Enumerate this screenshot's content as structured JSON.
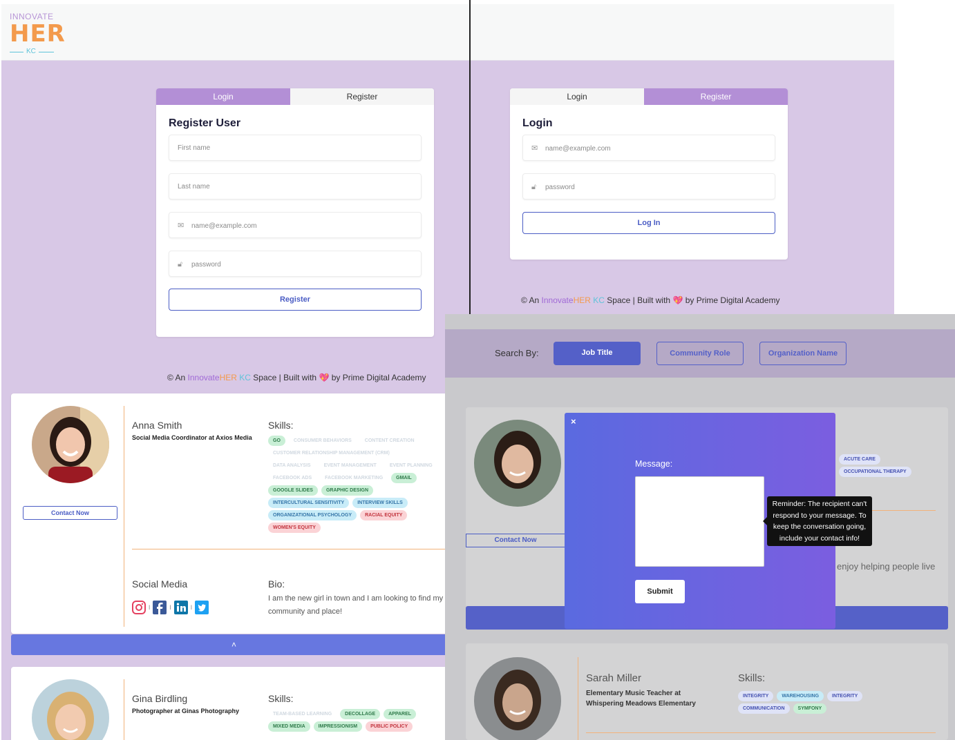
{
  "logo": {
    "top": "INNOVATE",
    "main": "HER",
    "bottom": "KC"
  },
  "register_card": {
    "tabs": [
      "Login",
      "Register"
    ],
    "title": "Register User",
    "first_name_placeholder": "First name",
    "last_name_placeholder": "Last name",
    "email_placeholder": "name@example.com",
    "password_placeholder": "password",
    "submit": "Register"
  },
  "login_card": {
    "tabs": [
      "Login",
      "Register"
    ],
    "title": "Login",
    "email_placeholder": "name@example.com",
    "password_placeholder": "password",
    "submit": "Log In"
  },
  "footer": {
    "prefix": "© An ",
    "brand_a": "Innovate",
    "brand_b": "HER",
    "brand_c": "KC",
    "suffix": " Space | Built with",
    "heart": "💖",
    "by": "by Prime Digital Academy"
  },
  "search": {
    "label": "Search By:",
    "buttons": [
      "Job Title",
      "Community Role",
      "Organization Name"
    ]
  },
  "profiles": [
    {
      "name": "Anna Smith",
      "role": "Social Media Coordinator at Axios Media",
      "skills_title": "Skills:",
      "contact": "Contact Now",
      "social_title": "Social Media",
      "bio_title": "Bio:",
      "bio": "I am the new girl in town and I am looking to find my community and place!",
      "collapse": "˄",
      "skills": [
        {
          "label": "GO",
          "color": "green"
        },
        {
          "label": "CONSUMER BEHAVIORS",
          "color": "faded"
        },
        {
          "label": "CONTENT CREATION",
          "color": "faded"
        },
        {
          "label": "CUSTOMER RELATIONSHIP MANAGEMENT (CRM)",
          "color": "faded"
        },
        {
          "label": "DATA ANALYSIS",
          "color": "faded"
        },
        {
          "label": "EVENT MANAGEMENT",
          "color": "faded"
        },
        {
          "label": "EVENT PLANNING",
          "color": "faded"
        },
        {
          "label": "FACEBOOK ADS",
          "color": "faded"
        },
        {
          "label": "FACEBOOK MARKETING",
          "color": "faded"
        },
        {
          "label": "GMAIL",
          "color": "green"
        },
        {
          "label": "GOOGLE SLIDES",
          "color": "green"
        },
        {
          "label": "GRAPHIC DESIGN",
          "color": "green"
        },
        {
          "label": "INTERCULTURAL SENSITIVITY",
          "color": "blue"
        },
        {
          "label": "INTERVIEW SKILLS",
          "color": "blue"
        },
        {
          "label": "ORGANIZATIONAL PSYCHOLOGY",
          "color": "blue"
        },
        {
          "label": "RACIAL EQUITY",
          "color": "red"
        },
        {
          "label": "WOMEN'S EQUITY",
          "color": "red"
        }
      ]
    },
    {
      "name": "Gina Birdling",
      "role": "Photographer at Ginas Photography",
      "skills_title": "Skills:",
      "skills": [
        {
          "label": "TEAM-BASED LEARNING",
          "color": "faded"
        },
        {
          "label": "DECOLLAGE",
          "color": "green"
        },
        {
          "label": "APPAREL",
          "color": "green"
        },
        {
          "label": "MIXED MEDIA",
          "color": "green"
        },
        {
          "label": "IMPRESSIONISM",
          "color": "green"
        },
        {
          "label": "PUBLIC POLICY",
          "color": "red"
        }
      ]
    },
    {
      "contact": "Contact Now",
      "skills": [
        {
          "label": "ACUTE CARE",
          "color": "indigo"
        },
        {
          "label": "OCCUPATIONAL THERAPY",
          "color": "indigo"
        }
      ],
      "bio_partial": "enjoy helping people live"
    },
    {
      "name": "Sarah Miller",
      "role": "Elementary Music Teacher at Whispering Meadows Elementary",
      "skills_title": "Skills:",
      "skills": [
        {
          "label": "INTEGRITY",
          "color": "indigo"
        },
        {
          "label": "WAREHOUSING",
          "color": "blue"
        },
        {
          "label": "INTEGRITY",
          "color": "indigo"
        },
        {
          "label": "COMMUNICATION",
          "color": "indigo"
        },
        {
          "label": "SYMFONY",
          "color": "green"
        }
      ]
    }
  ],
  "modal": {
    "close": "×",
    "label": "Message:",
    "submit": "Submit",
    "tooltip": "Reminder: The recipient can't respond to your message. To keep the conversation going, include your contact info!"
  },
  "colors": {
    "lavender": "#d8c8e6",
    "tab_active": "#b38fd6",
    "accent_blue": "#4a5cc4",
    "collapse_bar": "#6777e0"
  },
  "icons": {
    "email": "envelope-icon",
    "password": "lock-icon",
    "social": [
      "instagram-icon",
      "facebook-icon",
      "linkedin-icon",
      "twitter-icon"
    ]
  }
}
